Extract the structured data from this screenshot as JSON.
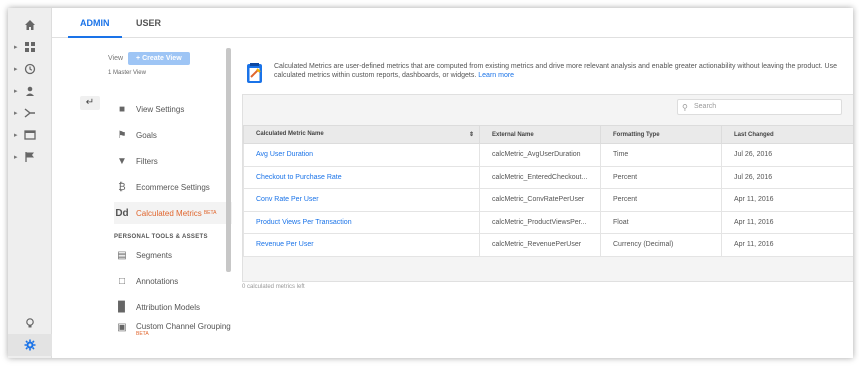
{
  "tabs": [
    {
      "label": "ADMIN",
      "active": true
    },
    {
      "label": "USER",
      "active": false
    }
  ],
  "left_nav": {
    "items": [
      "home-icon",
      "dashboard-icon",
      "clock-icon",
      "person-icon",
      "acquisition-icon",
      "behavior-icon",
      "flag-icon"
    ],
    "bottom": [
      "lightbulb-icon",
      "gear-icon"
    ]
  },
  "view_column": {
    "view_label": "View",
    "create_view_label": "+ Create View",
    "master_view": "1 Master View",
    "back_icon": "back-arrow-icon",
    "items": [
      {
        "label": "View Settings",
        "icon": "document-icon"
      },
      {
        "label": "Goals",
        "icon": "flag-icon"
      },
      {
        "label": "Filters",
        "icon": "filter-icon"
      },
      {
        "label": "Ecommerce Settings",
        "icon": "cart-icon"
      },
      {
        "label": "Calculated Metrics",
        "icon": "calculated-icon",
        "badge": "BETA",
        "active": true
      }
    ],
    "section_label": "PERSONAL TOOLS & ASSETS",
    "personal_items": [
      {
        "label": "Segments",
        "icon": "segments-icon"
      },
      {
        "label": "Annotations",
        "icon": "annotations-icon"
      },
      {
        "label": "Attribution Models",
        "icon": "bar-chart-icon"
      },
      {
        "label": "Custom Channel Grouping",
        "icon": "channel-icon",
        "badge": "BETA"
      }
    ]
  },
  "info": {
    "text": "Calculated Metrics are user-defined metrics that are computed from existing metrics and drive more relevant analysis and enable greater actionability without leaving the product. Use calculated metrics within custom reports, dashboards, or widgets.",
    "link": "Learn more"
  },
  "search": {
    "placeholder": "Search"
  },
  "table": {
    "headers": [
      "Calculated Metric Name",
      "External Name",
      "Formatting Type",
      "Last Changed"
    ],
    "rows": [
      [
        "Avg User Duration",
        "calcMetric_AvgUserDuration",
        "Time",
        "Jul 26, 2016"
      ],
      [
        "Checkout to Purchase Rate",
        "calcMetric_EnteredCheckout...",
        "Percent",
        "Jul 26, 2016"
      ],
      [
        "Conv Rate Per User",
        "calcMetric_ConvRatePerUser",
        "Percent",
        "Apr 11, 2016"
      ],
      [
        "Product Views Per Transaction",
        "calcMetric_ProductViewsPer...",
        "Float",
        "Apr 11, 2016"
      ],
      [
        "Revenue Per User",
        "calcMetric_RevenuePerUser",
        "Currency (Decimal)",
        "Apr 11, 2016"
      ]
    ]
  },
  "footer": "0 calculated metrics left"
}
